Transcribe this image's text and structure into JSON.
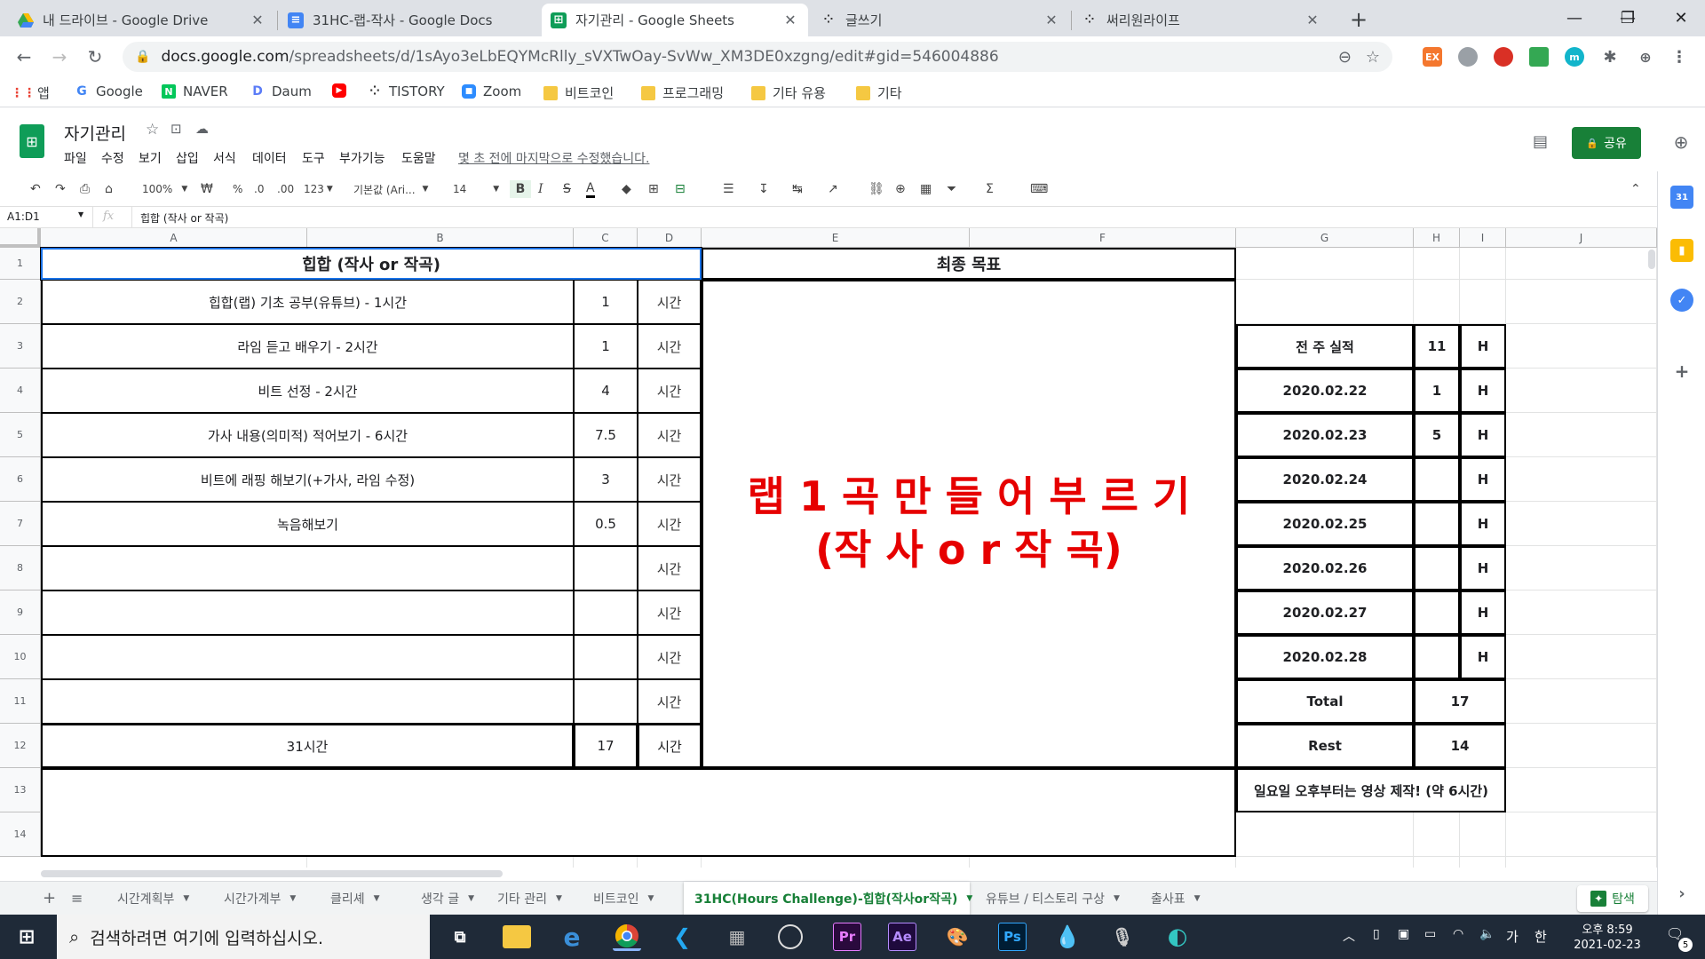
{
  "browser": {
    "tabs": [
      {
        "title": "내 드라이브 - Google Drive",
        "icon": "google-drive-icon",
        "active": false
      },
      {
        "title": "31HC-랩-작사 - Google Docs",
        "icon": "google-docs-icon",
        "active": false
      },
      {
        "title": "자기관리 - Google Sheets",
        "icon": "google-sheets-icon",
        "active": true
      },
      {
        "title": "글쓰기",
        "icon": "tistory-icon",
        "active": false
      },
      {
        "title": "써리원라이프",
        "icon": "tistory-icon",
        "active": false
      }
    ],
    "new_tab": "+",
    "url_host": "docs.google.com",
    "url_path": "/spreadsheets/d/1sAyo3eLbEQYMcRlly_sVXTwOay-SvWw_XM3DE0xzgng/edit#gid=546004886",
    "extensions": [
      "EX",
      "",
      "",
      "",
      "m",
      "",
      ""
    ],
    "bookmarks": [
      {
        "label": "앱",
        "icon": "apps-grid-icon"
      },
      {
        "label": "Google",
        "icon": "google-icon"
      },
      {
        "label": "NAVER",
        "icon": "naver-icon"
      },
      {
        "label": "Daum",
        "icon": "daum-icon"
      },
      {
        "label": "",
        "icon": "youtube-icon"
      },
      {
        "label": "TISTORY",
        "icon": "tistory-icon"
      },
      {
        "label": "Zoom",
        "icon": "zoom-icon"
      },
      {
        "label": "비트코인",
        "icon": "folder-icon"
      },
      {
        "label": "프로그래밍",
        "icon": "folder-icon"
      },
      {
        "label": "기타 유용",
        "icon": "folder-icon"
      },
      {
        "label": "기타",
        "icon": "folder-icon"
      }
    ]
  },
  "sheets": {
    "title": "자기관리",
    "menu": [
      "파일",
      "수정",
      "보기",
      "삽입",
      "서식",
      "데이터",
      "도구",
      "부가기능",
      "도움말"
    ],
    "last_edit": "몇 초 전에 마지막으로 수정했습니다.",
    "share": "공유",
    "toolbar": {
      "zoom": "100%",
      "percent": "%",
      "dec0": ".0",
      "dec00": ".00",
      "fmt123": "123",
      "font": "기본값 (Ari...",
      "size": "14"
    },
    "name_box": "A1:D1",
    "fx": "fx",
    "formula": "힙합 (작사 or 작곡)",
    "columns": [
      "A",
      "B",
      "C",
      "D",
      "E",
      "F",
      "G",
      "H",
      "I",
      "J"
    ],
    "rows": [
      "1",
      "2",
      "3",
      "4",
      "5",
      "6",
      "7",
      "8",
      "9",
      "10",
      "11",
      "12",
      "13",
      "14"
    ],
    "header_left": "힙합 (작사 or 작곡)",
    "header_right": "최종 목표",
    "tasks": [
      {
        "label": "힙합(랩) 기초 공부(유튜브) - 1시간",
        "hours": "1",
        "unit": "시간"
      },
      {
        "label": "라임 듣고 배우기 - 2시간",
        "hours": "1",
        "unit": "시간"
      },
      {
        "label": "비트 선정 - 2시간",
        "hours": "4",
        "unit": "시간"
      },
      {
        "label": "가사 내용(의미적) 적어보기 - 6시간",
        "hours": "7.5",
        "unit": "시간"
      },
      {
        "label": "비트에 래핑 해보기(+가사, 라임 수정)",
        "hours": "3",
        "unit": "시간"
      },
      {
        "label": "녹음해보기",
        "hours": "0.5",
        "unit": "시간"
      },
      {
        "label": "",
        "hours": "",
        "unit": "시간"
      },
      {
        "label": "",
        "hours": "",
        "unit": "시간"
      },
      {
        "label": "",
        "hours": "",
        "unit": "시간"
      },
      {
        "label": "",
        "hours": "",
        "unit": "시간"
      }
    ],
    "total_row": {
      "label": "31시간",
      "hours": "17",
      "unit": "시간"
    },
    "goal_line1": "랩 1 곡 만 들 어 부 르 기",
    "goal_line2": "(작 사 o r 작 곡)",
    "goal_color": "#e60000",
    "log_header": {
      "label": "전 주 실적",
      "value": "11",
      "unit": "H"
    },
    "log": [
      {
        "date": "2020.02.22",
        "value": "1",
        "unit": "H"
      },
      {
        "date": "2020.02.23",
        "value": "5",
        "unit": "H"
      },
      {
        "date": "2020.02.24",
        "value": "",
        "unit": "H"
      },
      {
        "date": "2020.02.25",
        "value": "",
        "unit": "H"
      },
      {
        "date": "2020.02.26",
        "value": "",
        "unit": "H"
      },
      {
        "date": "2020.02.27",
        "value": "",
        "unit": "H"
      },
      {
        "date": "2020.02.28",
        "value": "",
        "unit": "H"
      }
    ],
    "total": {
      "label": "Total",
      "value": "17"
    },
    "rest": {
      "label": "Rest",
      "value": "14"
    },
    "note": "일요일 오후부터는 영상 제작! (약 6시간)",
    "sheet_tabs": [
      "시간계획부",
      "시간가계부",
      "클리셰",
      "생각 글",
      "기타 관리",
      "비트코인",
      "31HC(Hours Challenge)-힙합(작사or작곡)",
      "유튜브 / 티스토리 구상",
      "출사표"
    ],
    "active_sheet_index": 6,
    "explore": "탐색",
    "brand_green": "#188038"
  },
  "taskbar": {
    "search_placeholder": "검색하려면 여기에 입력하십시오.",
    "apps": [
      "task-view-icon",
      "file-explorer-icon",
      "edge-legacy-icon",
      "chrome-icon",
      "vscode-icon",
      "calculator-icon",
      "obs-icon",
      "premiere-icon",
      "after-effects-icon",
      "paint-icon",
      "photoshop-icon",
      "app-icon",
      "microphone-icon",
      "edge-icon"
    ],
    "app_labels": {
      "premiere": "Pr",
      "after_effects": "Ae",
      "photoshop": "Ps"
    },
    "ime1": "가",
    "ime2": "한",
    "time": "오후 8:59",
    "date": "2021-02-23",
    "notifications": "5"
  }
}
